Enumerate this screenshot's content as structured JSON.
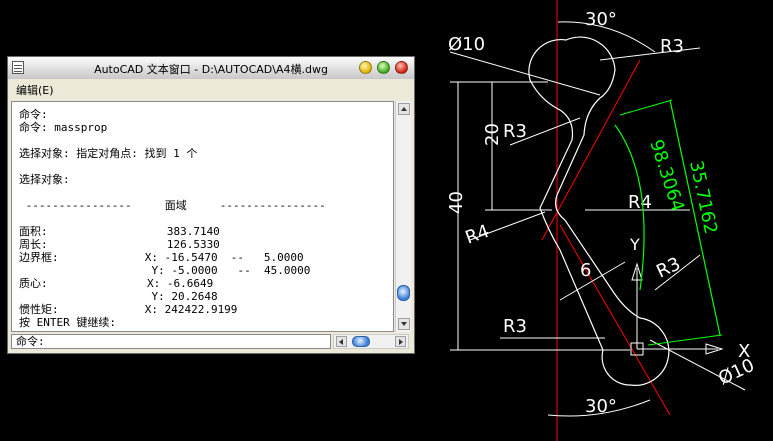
{
  "window": {
    "title": "AutoCAD 文本窗口 - D:\\AUTOCAD\\A4横.dwg",
    "menu_edit": "编辑(E)"
  },
  "text_lines": [
    "命令:",
    "命令: massprop",
    "",
    "选择对象: 指定对角点: 找到 1 个",
    "",
    "选择对象:",
    "",
    " ----------------     面域     ----------------",
    "",
    "面积:                  383.7140",
    "周长:                  126.5330",
    "边界框:             X: -16.5470  --   5.0000",
    "                    Y: -5.0000   --  45.0000",
    "质心:               X: -6.6649",
    "                    Y: 20.2648",
    "惯性矩:             X: 242422.9199",
    "按 ENTER 键继续:"
  ],
  "command_prompt": "命令:",
  "drawing": {
    "dim_angle_top": "30°",
    "dim_angle_bottom": "30°",
    "dim_dia_top": "Ø10",
    "dim_dia_bottom": "Ø10",
    "dim_r3_top_right": "R3",
    "dim_r3_left": "R3",
    "dim_r3_bottom_left": "R3",
    "dim_r3_right": "R3",
    "dim_r4_left": "R4",
    "dim_r4_right": "R4",
    "dim_20": "20",
    "dim_40": "40",
    "dim_6": "6",
    "dim_arc": "98.3064",
    "dim_aligned": "35.7162",
    "axis_x": "X",
    "axis_y": "Y",
    "colors": {
      "line": "#ffffff",
      "centerline": "#ff0000",
      "dimension_green": "#00ff00",
      "background": "#000000"
    }
  }
}
